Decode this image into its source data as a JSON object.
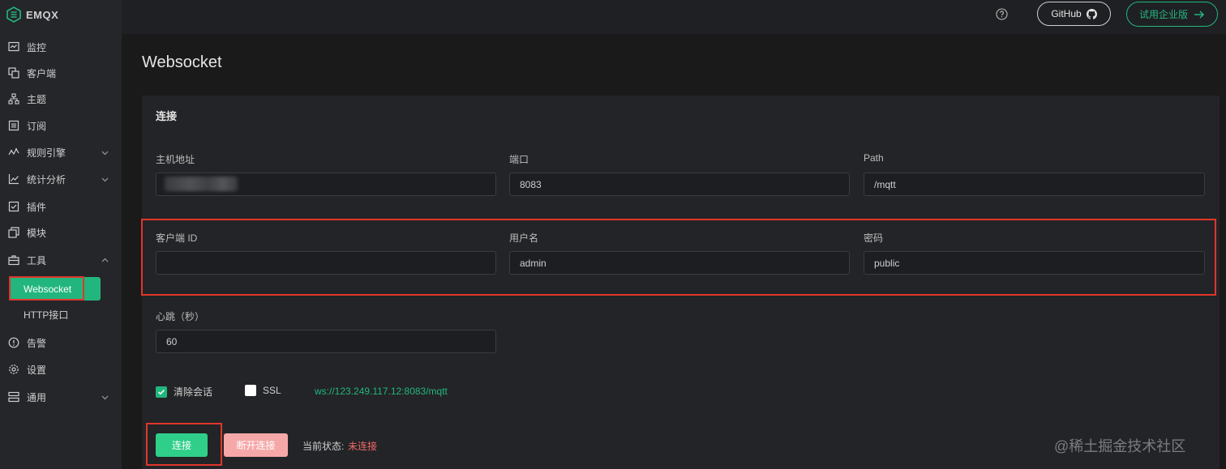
{
  "brand": {
    "name": "EMQX",
    "accent": "#22b67e"
  },
  "sidebar": {
    "items": [
      {
        "label": "监控",
        "icon": "monitor-icon"
      },
      {
        "label": "客户端",
        "icon": "clients-icon"
      },
      {
        "label": "主题",
        "icon": "topics-icon"
      },
      {
        "label": "订阅",
        "icon": "subscriptions-icon"
      },
      {
        "label": "规则引擎",
        "icon": "rule-engine-icon",
        "expandable": true
      },
      {
        "label": "统计分析",
        "icon": "analytics-icon",
        "expandable": true
      },
      {
        "label": "插件",
        "icon": "plugins-icon"
      },
      {
        "label": "模块",
        "icon": "modules-icon"
      },
      {
        "label": "工具",
        "icon": "tools-icon",
        "expandable": true,
        "expanded": true
      },
      {
        "label": "告警",
        "icon": "alarm-icon"
      },
      {
        "label": "设置",
        "icon": "settings-icon"
      },
      {
        "label": "通用",
        "icon": "general-icon",
        "expandable": true
      }
    ],
    "tools_sub": {
      "active": "Websocket",
      "other": "HTTP接口"
    }
  },
  "header": {
    "help_icon": "question-icon",
    "github_label": "GitHub",
    "enterprise_label": "试用企业版"
  },
  "page": {
    "title": "Websocket"
  },
  "connection": {
    "section_title": "连接",
    "host": {
      "label": "主机地址",
      "value": ""
    },
    "port": {
      "label": "端口",
      "value": "8083"
    },
    "path": {
      "label": "Path",
      "value": "/mqtt"
    },
    "client_id": {
      "label": "客户端 ID",
      "value": ""
    },
    "username": {
      "label": "用户名",
      "value": "admin"
    },
    "password": {
      "label": "密码",
      "value": "public"
    },
    "keepalive": {
      "label": "心跳（秒）",
      "value": "60"
    },
    "clean_session": {
      "label": "清除会话",
      "checked": true
    },
    "ssl": {
      "label": "SSL",
      "checked": false
    },
    "ws_url": "ws://123.249.117.12:8083/mqtt",
    "connect_label": "连接",
    "disconnect_label": "断开连接",
    "status_label": "当前状态:",
    "status_value": "未连接"
  },
  "watermark": "@稀土掘金技术社区"
}
